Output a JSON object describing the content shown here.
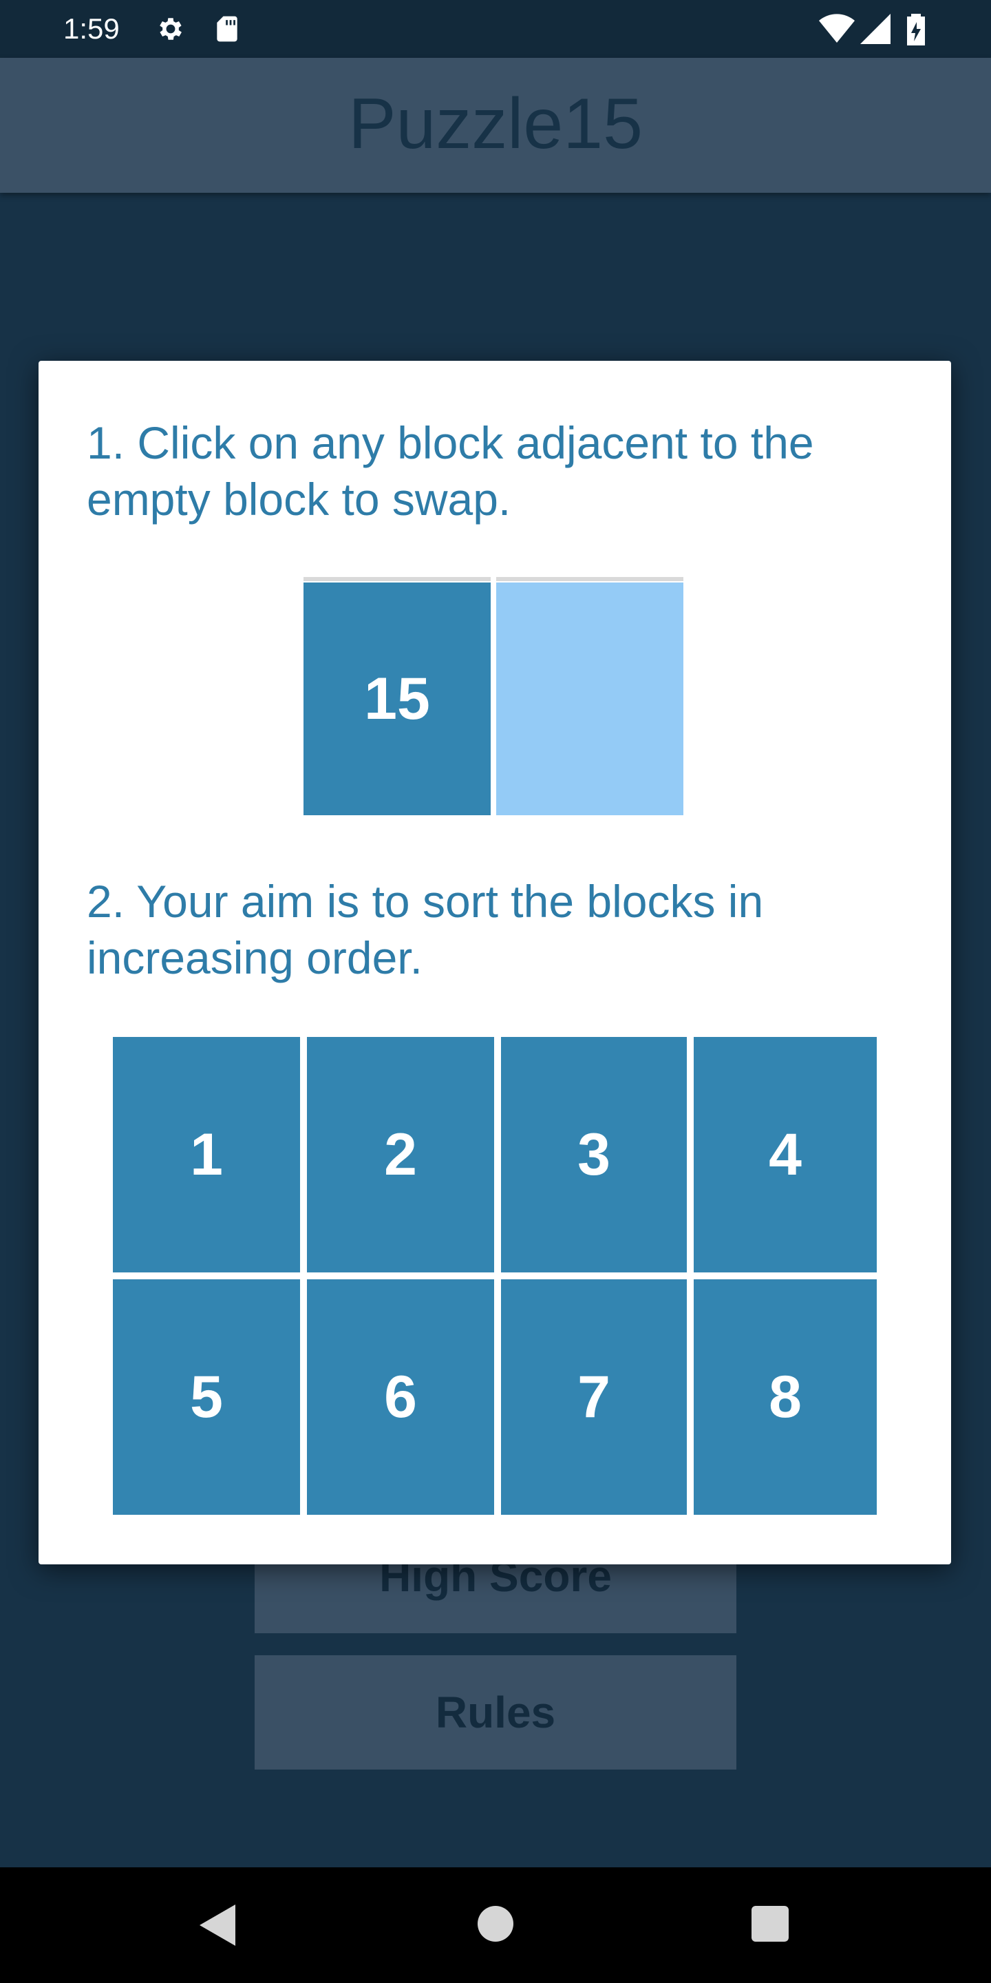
{
  "status_bar": {
    "time": "1:59",
    "icons_left": [
      "gear-icon",
      "sd-card-icon"
    ],
    "icons_right": [
      "wifi-icon",
      "signal-icon",
      "battery-charging-icon"
    ]
  },
  "app_bar": {
    "title": "Puzzle15"
  },
  "menu": {
    "high_score_label": "High Score",
    "rules_label": "Rules"
  },
  "dialog": {
    "rule_1": "1. Click on any block adjacent to the empty block to swap.",
    "example_tile": "15",
    "rule_2": "2. Your aim is to sort the blocks in increasing order.",
    "grid_tiles": [
      "1",
      "2",
      "3",
      "4",
      "5",
      "6",
      "7",
      "8"
    ]
  },
  "colors": {
    "background": "#173247",
    "app_bar": "#3b5166",
    "tile": "#3385b1",
    "empty_tile": "#94cbf6",
    "rule_text": "#2e7ca8"
  },
  "nav_bar": {
    "icons": [
      "back-icon",
      "home-icon",
      "recents-icon"
    ]
  }
}
